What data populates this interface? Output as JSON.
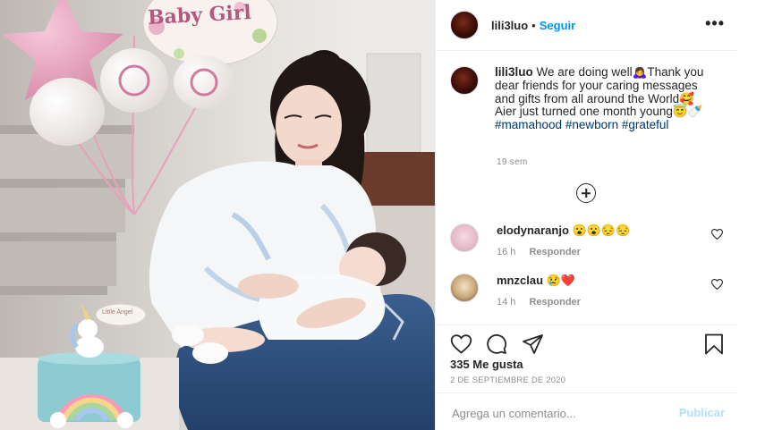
{
  "photo": {
    "balloon_text": "Baby Girl",
    "cake_topper_text": "Little Angel"
  },
  "header": {
    "username": "lili3luo",
    "separator": "•",
    "follow_label": "Seguir",
    "more_label": "•••"
  },
  "caption": {
    "username": "lili3luo",
    "text_1": "We are doing well🙇‍♀️Thank you dear friends for your caring messages and gifts from all around the World🥰 Aier just turned one month young😇🍼",
    "hashtag_1": "#mamahood",
    "hashtag_2": "#newborn",
    "hashtag_3": "#grateful",
    "time": "19 sem"
  },
  "comments": [
    {
      "username": "elodynaranjo",
      "text": "😮😮😔😔",
      "time": "16 h",
      "reply_label": "Responder"
    },
    {
      "username": "mnzclau",
      "text": "😢❤️",
      "time": "14 h",
      "reply_label": "Responder"
    }
  ],
  "likes_text": "335 Me gusta",
  "date_text": "2 DE SEPTIEMBRE DE 2020",
  "add_comment": {
    "placeholder": "Agrega un comentario...",
    "publish_label": "Publicar"
  },
  "colors": {
    "accent": "#0095f6",
    "publish_disabled": "#b2dffc",
    "text": "#262626",
    "muted": "#8e8e8e",
    "hashtag": "#00376b"
  },
  "icons": [
    "more-options-icon",
    "add-circle-icon",
    "heart-icon",
    "comment-icon",
    "share-icon",
    "bookmark-icon"
  ]
}
